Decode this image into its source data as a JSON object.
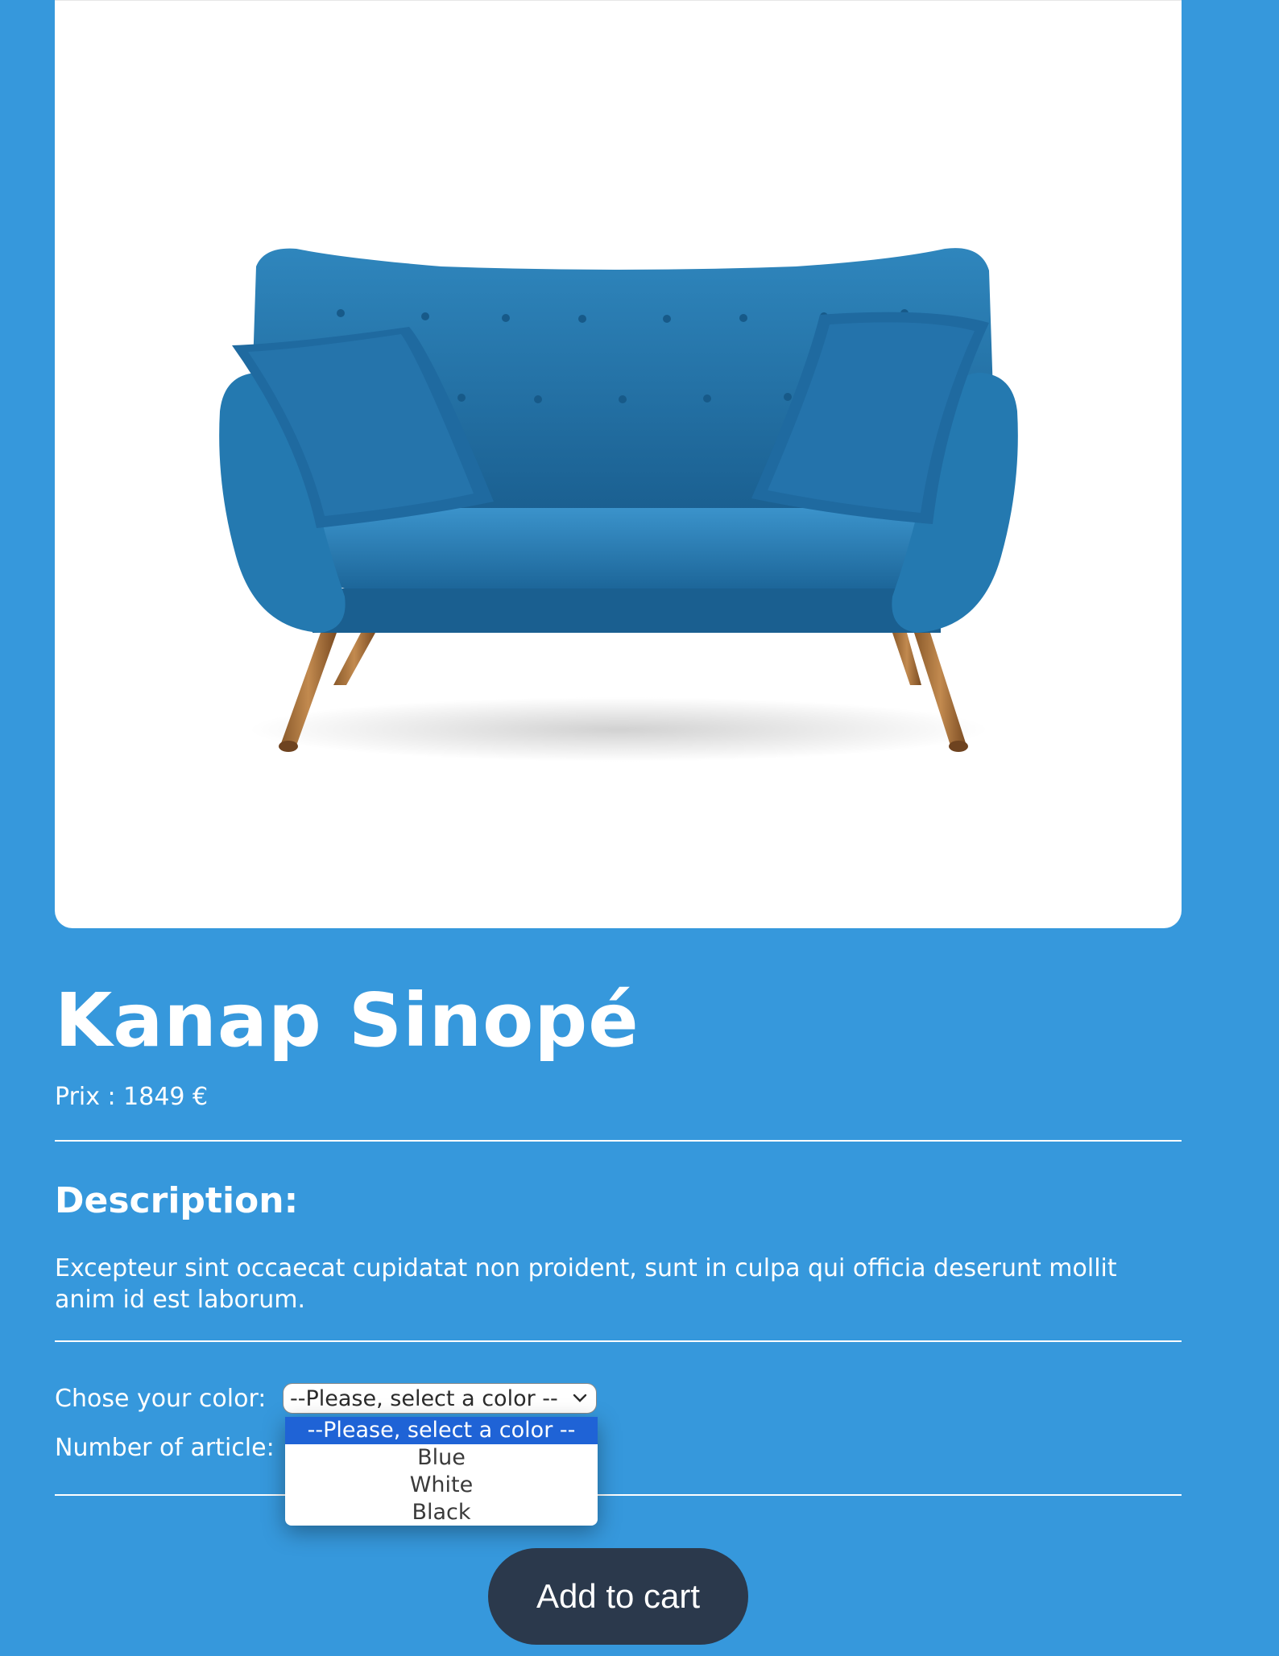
{
  "product": {
    "name": "Kanap Sinopé",
    "price_text": "Prix : 1849 €",
    "description_heading": "Description:",
    "description": "Excepteur sint occaecat cupidatat non proident, sunt in culpa qui officia deserunt mollit anim id est laborum."
  },
  "options": {
    "color_label": "Chose your color:",
    "color_selected": "--Please, select a color --",
    "color_options": [
      "--Please, select a color --",
      "Blue",
      "White",
      "Black"
    ],
    "quantity_label": "Number of article:"
  },
  "actions": {
    "add_to_cart": "Add to cart"
  },
  "colors": {
    "background": "#3698dc",
    "sofa": "#1f6fa6",
    "button": "#2b394c",
    "option_highlight": "#1f63d6"
  }
}
